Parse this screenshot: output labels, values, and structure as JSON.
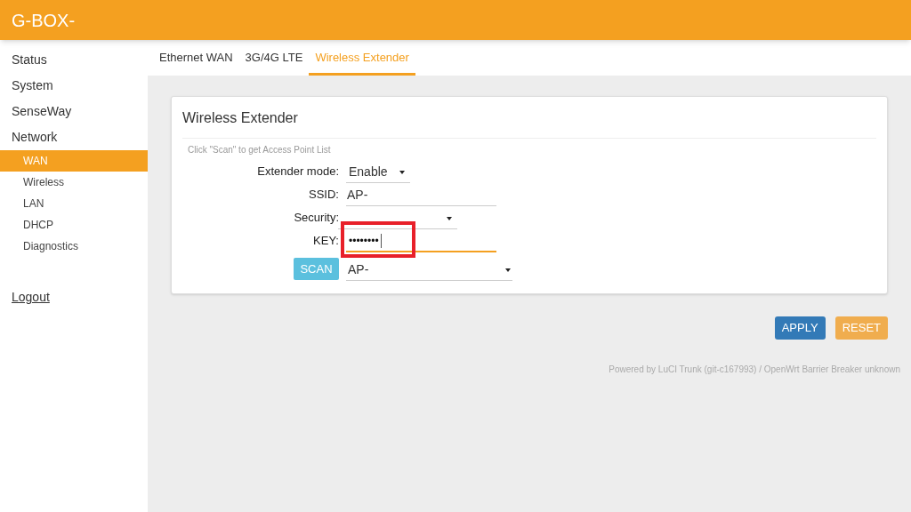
{
  "header": {
    "title": "G-BOX-"
  },
  "sidebar": {
    "items": [
      {
        "label": "Status",
        "selected": false
      },
      {
        "label": "System",
        "selected": false
      },
      {
        "label": "SenseWay",
        "selected": false
      },
      {
        "label": "Network",
        "selected": false,
        "children": [
          {
            "label": "WAN",
            "selected": true
          },
          {
            "label": "Wireless",
            "selected": false
          },
          {
            "label": "LAN",
            "selected": false
          },
          {
            "label": "DHCP",
            "selected": false
          },
          {
            "label": "Diagnostics",
            "selected": false
          }
        ]
      }
    ],
    "logout": "Logout"
  },
  "tabs": [
    {
      "label": "Ethernet WAN",
      "selected": false
    },
    {
      "label": "3G/4G LTE",
      "selected": false
    },
    {
      "label": "Wireless Extender",
      "selected": true
    }
  ],
  "section": {
    "title": "Wireless Extender",
    "hint": "Click \"Scan\" to get Access Point List",
    "fields": [
      {
        "kind": "select",
        "label": "Extender mode:",
        "value": "Enable",
        "focused": false,
        "highlighted": false
      },
      {
        "kind": "text",
        "label": "SSID:",
        "value": "AP-",
        "focused": false,
        "highlighted": false
      },
      {
        "kind": "select",
        "label": "Security:",
        "focused": false,
        "highlighted": false
      },
      {
        "kind": "password",
        "label": "KEY:",
        "value": "••••••••",
        "focused": true,
        "highlighted": true
      },
      {
        "kind": "scan",
        "button": "SCAN",
        "value": "AP-",
        "focused": false,
        "highlighted": false
      }
    ]
  },
  "buttons": [
    {
      "kind": "apply",
      "label": "APPLY"
    },
    {
      "kind": "reset",
      "label": "RESET"
    }
  ],
  "footer": "Powered by LuCI Trunk (git-c167993) / OpenWrt Barrier Breaker unknown"
}
